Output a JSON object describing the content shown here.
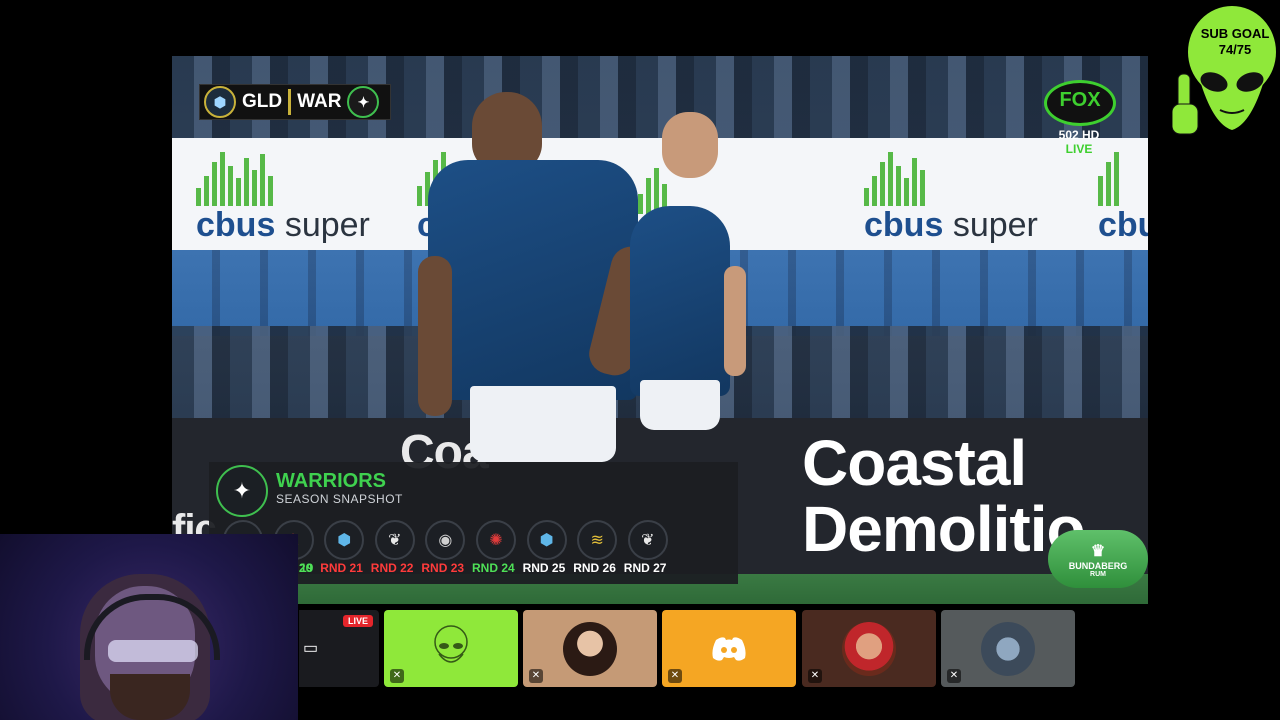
{
  "scorebug": {
    "home": "GLD",
    "away": "WAR"
  },
  "broadcaster": {
    "logo": "FOX",
    "channel": "502 HD",
    "status": "LIVE"
  },
  "sponsor_banner": {
    "brand": "cbus",
    "word": "super"
  },
  "board_ad": {
    "line1": "Coastal",
    "line2": "Demolitio",
    "partial_left": "Coa",
    "partial_left2": "fic"
  },
  "sponsor_bug": {
    "text": "BUNDABERG",
    "sub": "RUM"
  },
  "snapshot": {
    "team": "WARRIORS",
    "subtitle": "SEASON SNAPSHOT",
    "rounds": [
      {
        "label": "19",
        "result": "w",
        "icon": "magpie-icon"
      },
      {
        "label": "RND 20",
        "result": "w",
        "icon": "knight-icon"
      },
      {
        "label": "RND 21",
        "result": "l",
        "icon": "titan-icon"
      },
      {
        "label": "RND 22",
        "result": "l",
        "icon": "eagle-icon"
      },
      {
        "label": "RND 23",
        "result": "l",
        "icon": "bulldog-icon"
      },
      {
        "label": "RND 24",
        "result": "w",
        "icon": "dragon-icon"
      },
      {
        "label": "RND 25",
        "result": "u",
        "icon": "titan-icon"
      },
      {
        "label": "RND 26",
        "result": "u",
        "icon": "eel-icon"
      },
      {
        "label": "RND 27",
        "result": "u",
        "icon": "eagle-icon"
      }
    ]
  },
  "sub_goal": {
    "label": "SUB GOAL",
    "progress": "74/75"
  },
  "tiles": [
    {
      "name": "screen-share-tile",
      "live": "LIVE"
    },
    {
      "name": "alien-tile"
    },
    {
      "name": "participant-tile-1"
    },
    {
      "name": "discord-tile"
    },
    {
      "name": "participant-tile-2"
    },
    {
      "name": "participant-tile-3"
    }
  ],
  "colors": {
    "win": "#4ee057",
    "loss": "#ff3b3b",
    "accent_green": "#3fd14f",
    "discord": "#f5a623",
    "alien": "#8fe83a"
  }
}
